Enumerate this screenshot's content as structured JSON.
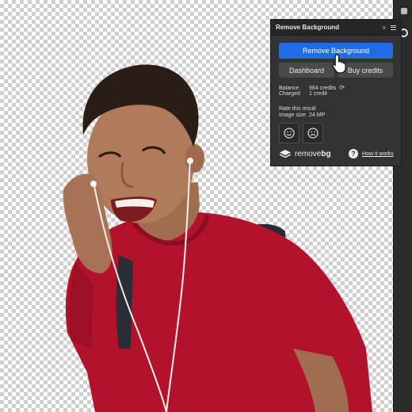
{
  "panel": {
    "title": "Remove Background",
    "remove_button": "Remove Background",
    "dashboard_button": "Dashboard",
    "buy_credits_button": "Buy credits",
    "balance_label": "Balance",
    "balance_value": "984 credits",
    "charged_label": "Charged",
    "charged_value": "1 credit",
    "rate_label": "Rate this result",
    "image_size_label": "Image size",
    "image_size_value": "24 MP",
    "brand_light": "remove",
    "brand_bold": "bg",
    "help_link": "How it works"
  },
  "colors": {
    "panel_bg": "#333333",
    "primary_button": "#1f6de0",
    "shirt": "#b3122c"
  },
  "icons": {
    "expand": "double-chevron-right-icon",
    "menu": "hamburger-menu-icon",
    "refresh": "refresh-icon",
    "happy": "smiley-face-icon",
    "sad": "sad-face-icon",
    "logo": "removebg-logo-icon",
    "help": "question-circle-icon",
    "cursor": "hand-pointer-icon"
  }
}
